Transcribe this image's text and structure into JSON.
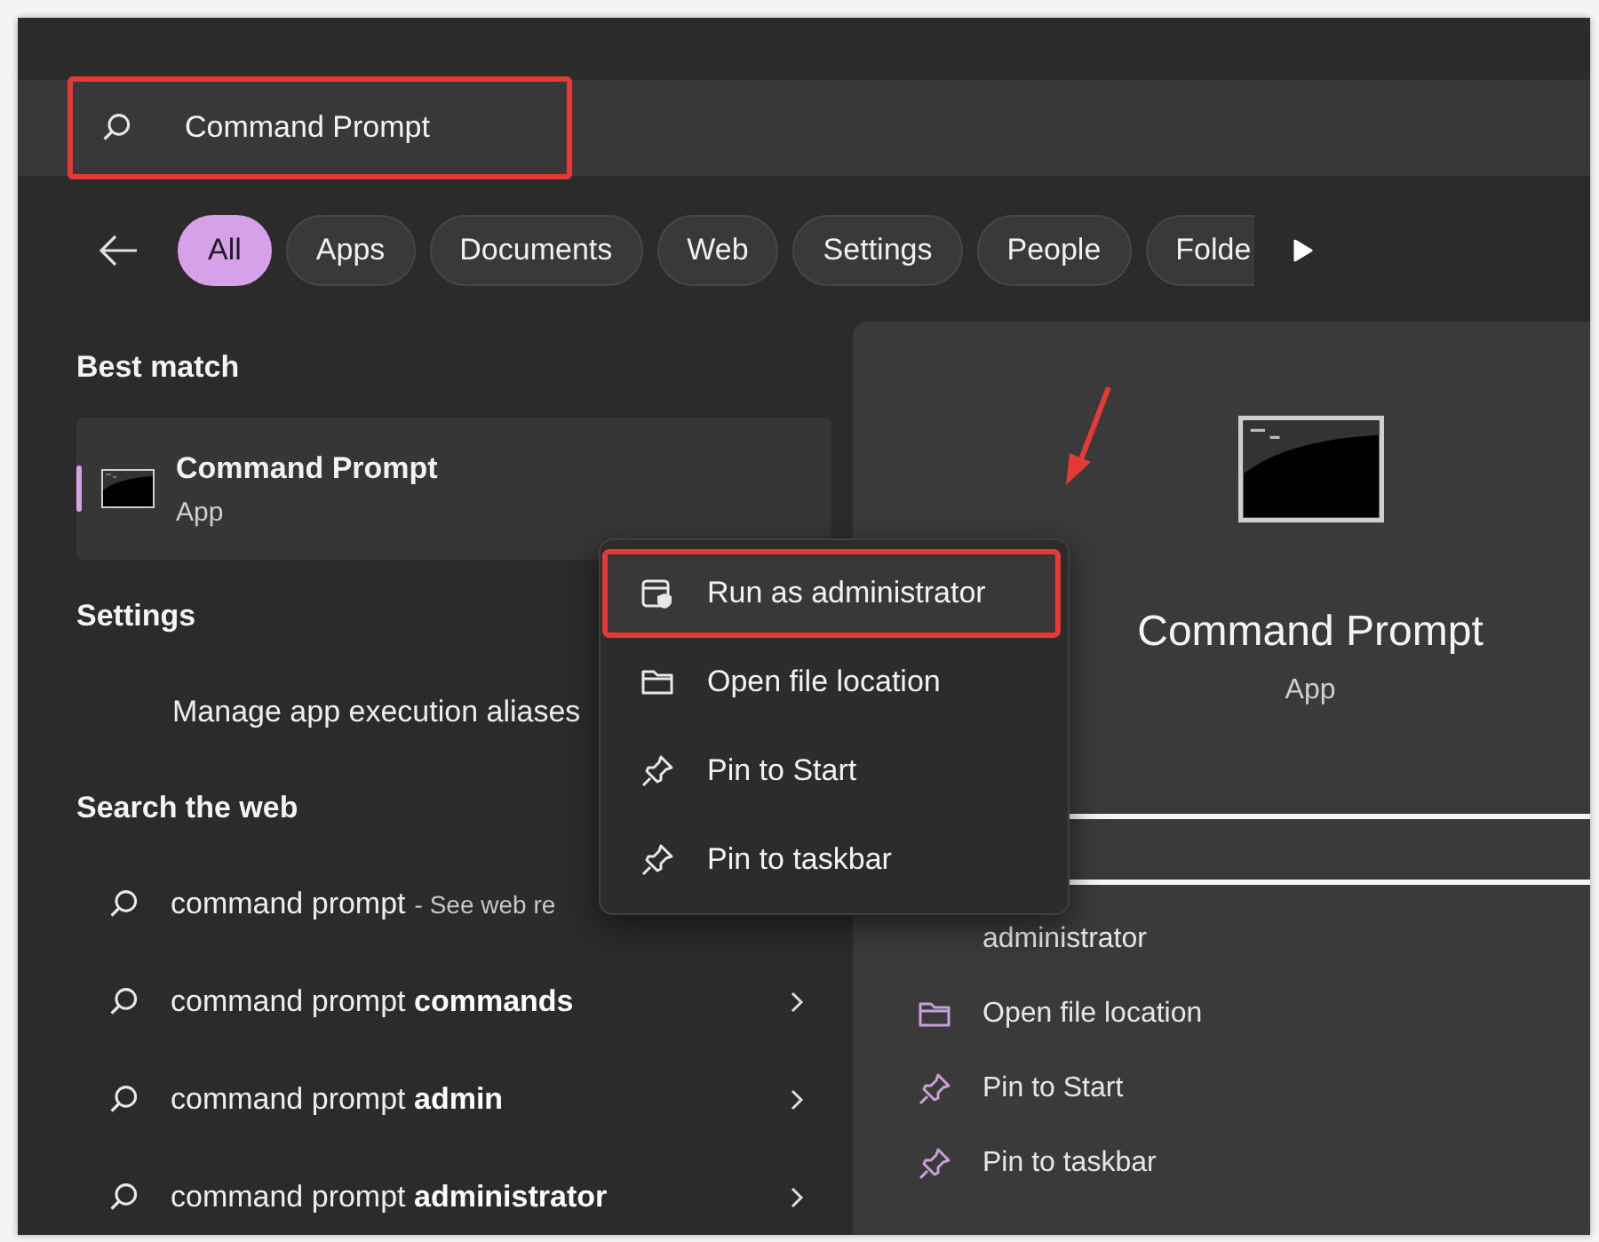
{
  "search": {
    "value": "Command Prompt",
    "highlighted": true
  },
  "filters": [
    {
      "label": "All",
      "selected": true
    },
    {
      "label": "Apps",
      "selected": false
    },
    {
      "label": "Documents",
      "selected": false
    },
    {
      "label": "Web",
      "selected": false
    },
    {
      "label": "Settings",
      "selected": false
    },
    {
      "label": "People",
      "selected": false
    },
    {
      "label": "Folde",
      "selected": false
    }
  ],
  "best_match": {
    "heading": "Best match",
    "title": "Command Prompt",
    "subtitle": "App",
    "selected": true
  },
  "settings": {
    "heading": "Settings",
    "items": [
      {
        "label": "Manage app execution aliases"
      }
    ]
  },
  "web": {
    "heading": "Search the web",
    "items": [
      {
        "text": "command prompt",
        "hint": "- See web re"
      },
      {
        "text": "command prompt **commands**",
        "chevron": true
      },
      {
        "text": "command prompt **admin**",
        "chevron": true
      },
      {
        "text": "command prompt **administrator**",
        "chevron": true
      }
    ]
  },
  "context_menu": {
    "items": [
      {
        "label": "Run as administrator",
        "kind": "shield",
        "highlighted": true
      },
      {
        "label": "Open file location",
        "kind": "folder",
        "highlighted": false
      },
      {
        "label": "Pin to Start",
        "kind": "pin",
        "highlighted": false
      },
      {
        "label": "Pin to taskbar",
        "kind": "pin",
        "highlighted": false
      }
    ]
  },
  "details": {
    "title": "Command Prompt",
    "subtitle": "App",
    "actions": [
      {
        "label": "administrator",
        "kind": "covered"
      },
      {
        "label": "Open file location",
        "kind": "folder"
      },
      {
        "label": "Pin to Start",
        "kind": "pin"
      },
      {
        "label": "Pin to taskbar",
        "kind": "pin"
      }
    ]
  }
}
